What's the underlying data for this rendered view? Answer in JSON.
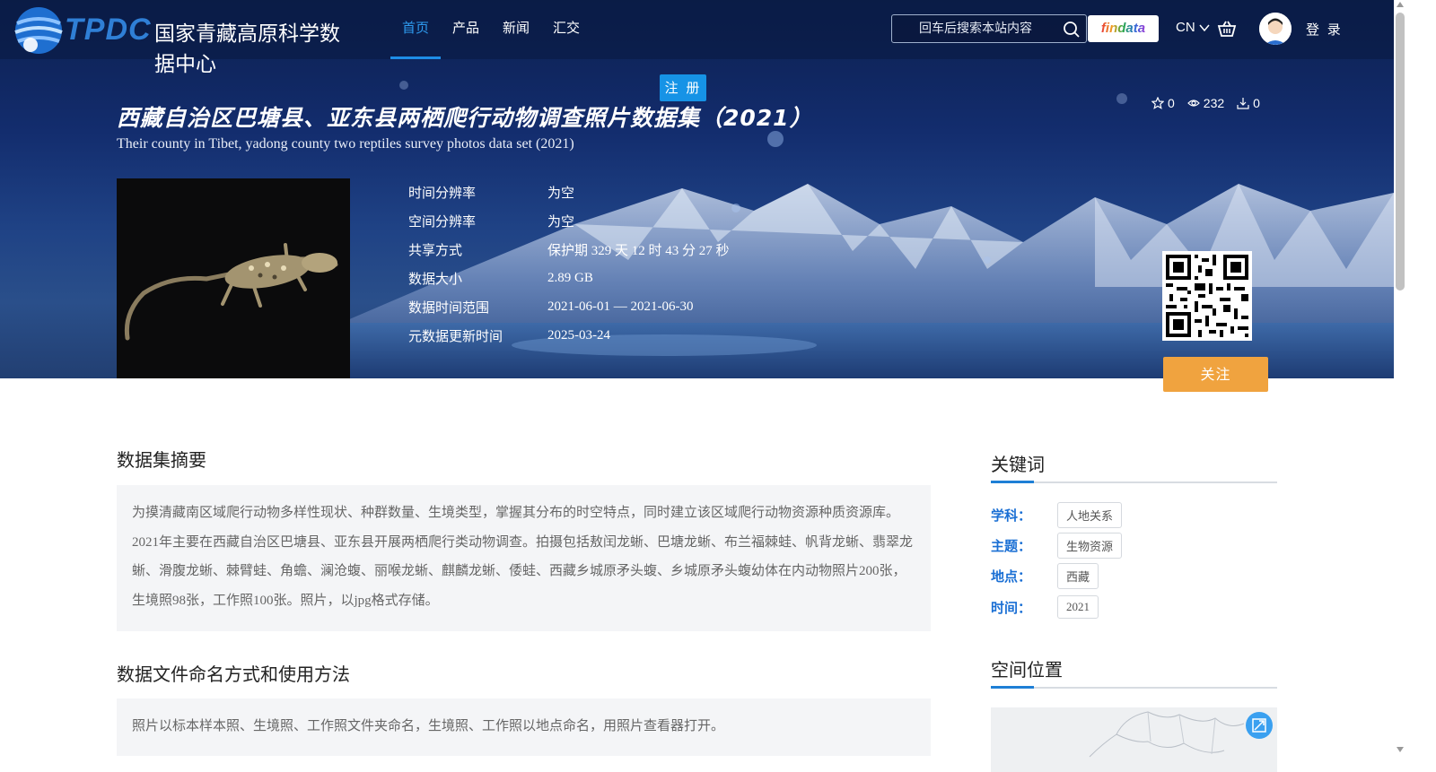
{
  "brand": {
    "logo_text": "TPDC",
    "logo_cn": "国家青藏高原科学数据中心"
  },
  "nav": {
    "items": [
      {
        "label": "首页",
        "active": true
      },
      {
        "label": "产品",
        "active": false
      },
      {
        "label": "新闻",
        "active": false
      },
      {
        "label": "汇交",
        "active": false
      }
    ]
  },
  "search": {
    "placeholder": "回车后搜索本站内容",
    "icon": "search-icon"
  },
  "header": {
    "findata_label": "findata",
    "lang_label": "CN",
    "cart_icon": "cart-icon",
    "login_label": "登 录",
    "register_label": "注 册"
  },
  "dataset": {
    "title_cn": "西藏自治区巴塘县、亚东县两栖爬行动物调查照片数据集（2021）",
    "title_en": "Their county in Tibet, yadong county two reptiles survey photos data set (2021)",
    "stats": {
      "stars": "0",
      "views": "232",
      "downloads": "0"
    },
    "meta": [
      {
        "label": "时间分辨率",
        "value": "为空"
      },
      {
        "label": "空间分辨率",
        "value": "为空"
      },
      {
        "label": "共享方式",
        "value": "保护期 329 天 12 时 43 分 27 秒"
      },
      {
        "label": "数据大小",
        "value": "2.89 GB"
      },
      {
        "label": "数据时间范围",
        "value": "2021-06-01 — 2021-06-30"
      },
      {
        "label": "元数据更新时间",
        "value": "2025-03-24"
      }
    ],
    "follow_label": "关注"
  },
  "abstract": {
    "title": "数据集摘要",
    "text": "为摸清藏南区域爬行动物多样性现状、种群数量、生境类型，掌握其分布的时空特点，同时建立该区域爬行动物资源种质资源库。2021年主要在西藏自治区巴塘县、亚东县开展两栖爬行类动物调查。拍摄包括敖闰龙蜥、巴塘龙蜥、布兰福棘蛙、帆背龙蜥、翡翠龙蜥、滑腹龙蜥、棘臂蛙、角蟾、澜沧蝮、丽喉龙蜥、麒麟龙蜥、倭蛙、西藏乡城原矛头蝮、乡城原矛头蝮幼体在内动物照片200张，生境照98张，工作照100张。照片，以jpg格式存储。"
  },
  "naming": {
    "title": "数据文件命名方式和使用方法",
    "text": "照片以标本样本照、生境照、工作照文件夹命名，生境照、工作照以地点命名，用照片查看器打开。"
  },
  "keywords": {
    "title": "关键词",
    "rows": [
      {
        "label": "学科：",
        "tag": "人地关系"
      },
      {
        "label": "主题：",
        "tag": "生物资源"
      },
      {
        "label": "地点：",
        "tag": "西藏"
      },
      {
        "label": "时间：",
        "tag": "2021"
      }
    ]
  },
  "spatial": {
    "title": "空间位置"
  },
  "colors": {
    "accent": "#1e8de6",
    "follow": "#f0a33f",
    "keyword_label": "#1a6fd4"
  }
}
